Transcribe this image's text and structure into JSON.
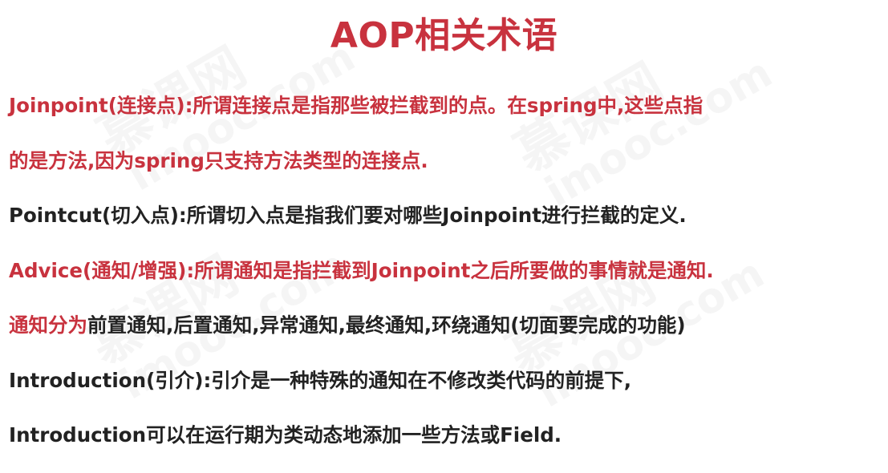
{
  "title": "AOP相关术语",
  "watermark": {
    "cn": "慕课网",
    "en": "imooc.com"
  },
  "lines": [
    {
      "red": "Joinpoint(连接点):所谓连接点是指那些被拦截到的点。在spring中,这些点指",
      "dark": ""
    },
    {
      "red": "的是方法,因为spring只支持方法类型的连接点.",
      "dark": ""
    },
    {
      "red": "",
      "dark": "Pointcut(切入点):所谓切入点是指我们要对哪些Joinpoint进行拦截的定义."
    },
    {
      "red": "Advice(通知/增强):所谓通知是指拦截到Joinpoint之后所要做的事情就是通知.",
      "dark": ""
    },
    {
      "red": "通知分为",
      "dark": "前置通知,后置通知,异常通知,最终通知,环绕通知(切面要完成的功能)"
    },
    {
      "red": "",
      "dark": "Introduction(引介):引介是一种特殊的通知在不修改类代码的前提下,"
    },
    {
      "red": "",
      "dark": "Introduction可以在运行期为类动态地添加一些方法或Field."
    }
  ],
  "colors": {
    "accent": "#c8323e",
    "text": "#222222"
  }
}
